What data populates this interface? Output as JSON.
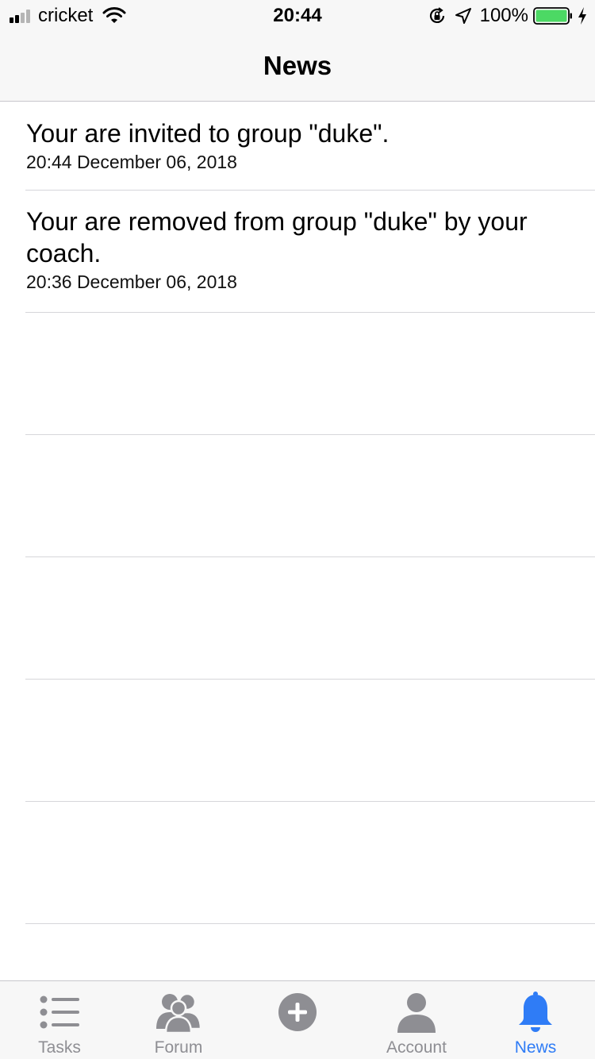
{
  "status_bar": {
    "carrier": "cricket",
    "time": "20:44",
    "battery_percent": "100%",
    "signal_bars_filled": 2,
    "signal_bars_total": 4,
    "battery_level": 1.0,
    "icons": [
      "signal-icon",
      "wifi-icon",
      "orientation-lock-icon",
      "location-arrow-icon",
      "battery-icon",
      "charging-bolt-icon"
    ]
  },
  "nav": {
    "title": "News"
  },
  "news": [
    {
      "message": "Your are invited to group \"duke\".",
      "date": "20:44 December 06, 2018"
    },
    {
      "message": "Your are removed from group \"duke\" by your coach.",
      "date": "20:36 December 06, 2018"
    }
  ],
  "tabs": [
    {
      "label": "Tasks",
      "icon": "list-icon",
      "active": false
    },
    {
      "label": "Forum",
      "icon": "people-icon",
      "active": false
    },
    {
      "label": "",
      "icon": "plus-circle-icon",
      "active": false
    },
    {
      "label": "Account",
      "icon": "person-icon",
      "active": false
    },
    {
      "label": "News",
      "icon": "bell-icon",
      "active": true
    }
  ],
  "colors": {
    "accent": "#2f7cf6",
    "tab_inactive": "#8e8e93",
    "bar_background": "#f7f7f7",
    "battery_fill": "#4cd964"
  }
}
